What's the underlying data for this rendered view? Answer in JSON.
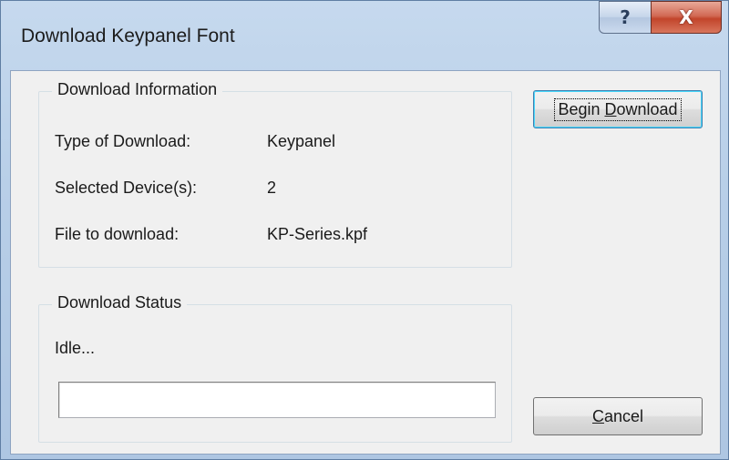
{
  "window": {
    "title": "Download Keypanel Font",
    "help_button_label": "?",
    "close_button_label": "X"
  },
  "download_information": {
    "group_title": "Download Information",
    "rows": [
      {
        "label": "Type of Download:",
        "value": "Keypanel"
      },
      {
        "label": "Selected Device(s):",
        "value": "2"
      },
      {
        "label": "File to download:",
        "value": "KP-Series.kpf"
      }
    ]
  },
  "download_status": {
    "group_title": "Download Status",
    "status_text": "Idle...",
    "progress_fraction": 0
  },
  "buttons": {
    "begin_download": {
      "label": "Begin Download",
      "access_key": "D",
      "focused": true
    },
    "cancel": {
      "label": "Cancel",
      "access_key": "C"
    }
  },
  "colors": {
    "title_bar": "#b8cfe8",
    "close_button": "#c2452b",
    "client_background": "#f0f0f0",
    "focus_border": "#3c7fb1"
  },
  "icons": {
    "help": "question-mark-icon",
    "close": "close-x-icon"
  }
}
